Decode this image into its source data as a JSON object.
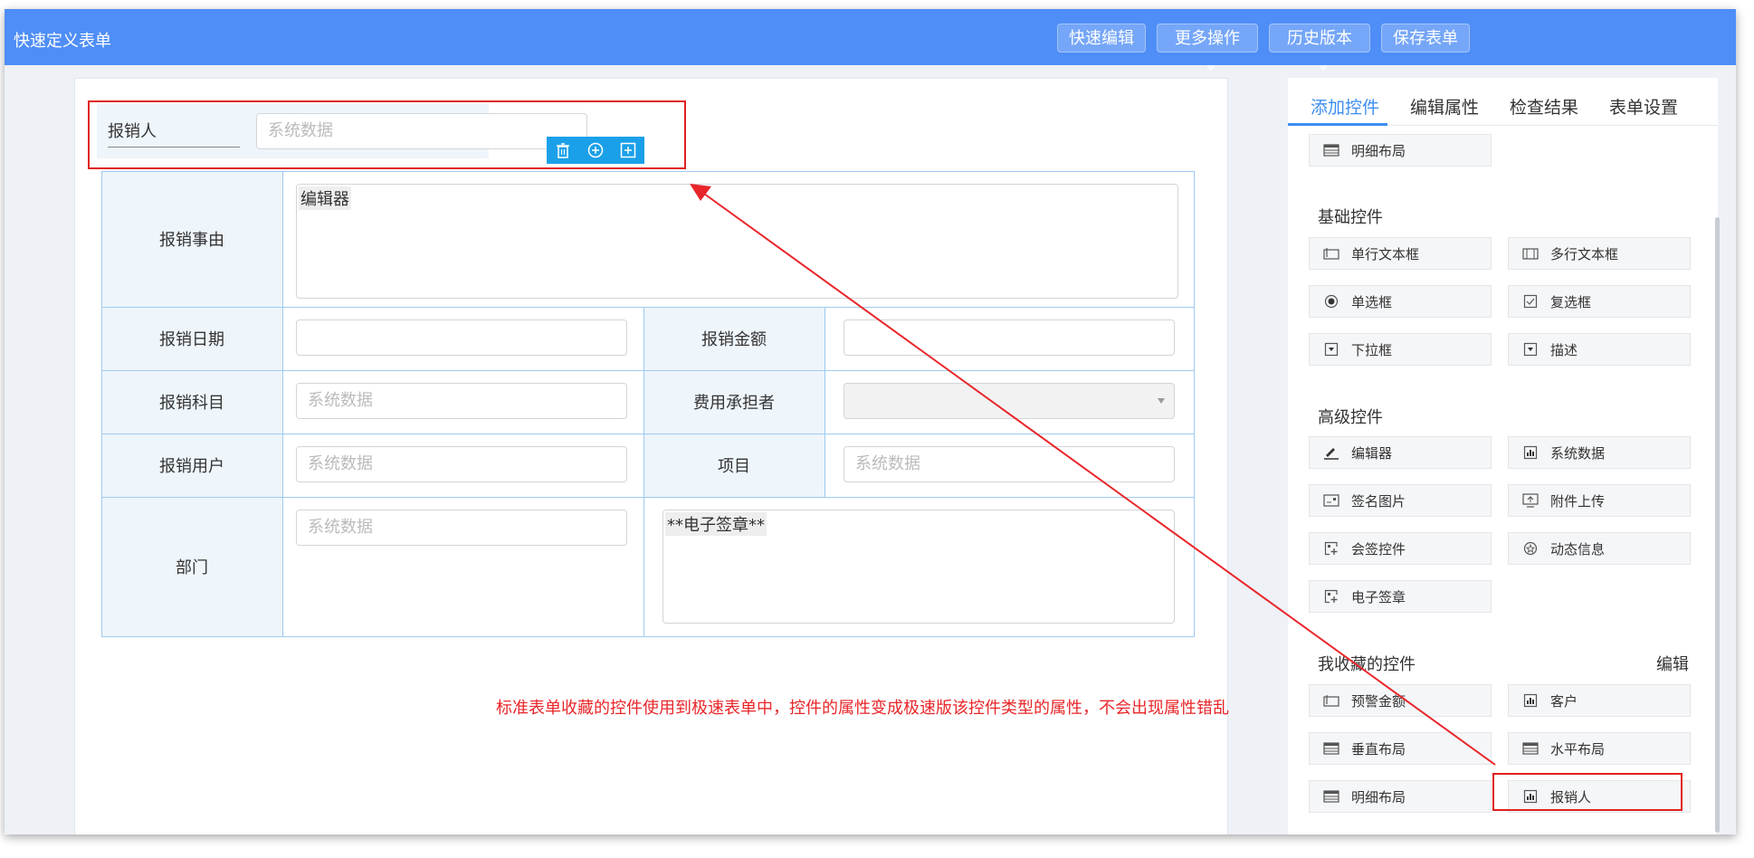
{
  "app": {
    "title": "快速定义表单"
  },
  "toolbar": {
    "quick_edit": "快速编辑",
    "more_ops": "更多操作",
    "history": "历史版本",
    "save": "保存表单"
  },
  "form": {
    "reimburser": {
      "label": "报销人",
      "placeholder": "系统数据"
    },
    "reason": {
      "label": "报销事由",
      "content": "编辑器"
    },
    "date": {
      "label": "报销日期"
    },
    "amount": {
      "label": "报销金额"
    },
    "subject": {
      "label": "报销科目",
      "placeholder": "系统数据"
    },
    "bearer": {
      "label": "费用承担者"
    },
    "user": {
      "label": "报销用户",
      "placeholder": "系统数据"
    },
    "project": {
      "label": "项目",
      "placeholder": "系统数据"
    },
    "dept": {
      "label": "部门",
      "placeholder": "系统数据"
    },
    "esign": {
      "content": "**电子签章**"
    }
  },
  "annotation": "标准表单收藏的控件使用到极速表单中，控件的属性变成极速版该控件类型的属性，不会出现属性错乱",
  "panel": {
    "tabs": [
      "添加控件",
      "编辑属性",
      "检查结果",
      "表单设置"
    ],
    "top_item": {
      "label": "明细布局",
      "icon": "table-layout-icon"
    },
    "basic": {
      "title": "基础控件",
      "items": [
        {
          "label": "单行文本框",
          "icon": "text-field-icon"
        },
        {
          "label": "多行文本框",
          "icon": "textarea-icon"
        },
        {
          "label": "单选框",
          "icon": "radio-icon"
        },
        {
          "label": "复选框",
          "icon": "checkbox-icon"
        },
        {
          "label": "下拉框",
          "icon": "dropdown-icon"
        },
        {
          "label": "描述",
          "icon": "description-icon"
        }
      ]
    },
    "advanced": {
      "title": "高级控件",
      "items": [
        {
          "label": "编辑器",
          "icon": "editor-icon"
        },
        {
          "label": "系统数据",
          "icon": "chart-icon"
        },
        {
          "label": "签名图片",
          "icon": "signature-image-icon"
        },
        {
          "label": "附件上传",
          "icon": "upload-icon"
        },
        {
          "label": "会签控件",
          "icon": "countersign-icon"
        },
        {
          "label": "动态信息",
          "icon": "dynamic-info-icon"
        },
        {
          "label": "电子签章",
          "icon": "seal-icon"
        }
      ]
    },
    "favorites": {
      "title": "我收藏的控件",
      "edit": "编辑",
      "items": [
        {
          "label": "预警金额",
          "icon": "text-field-icon"
        },
        {
          "label": "客户",
          "icon": "chart-icon"
        },
        {
          "label": "垂直布局",
          "icon": "table-layout-icon"
        },
        {
          "label": "水平布局",
          "icon": "table-layout-icon"
        },
        {
          "label": "明细布局",
          "icon": "table-layout-icon"
        },
        {
          "label": "报销人",
          "icon": "chart-icon"
        }
      ]
    }
  },
  "colors": {
    "accent": "#4f8ef7",
    "annotation_red": "#e8262a",
    "grid": "#9fcaf0"
  }
}
